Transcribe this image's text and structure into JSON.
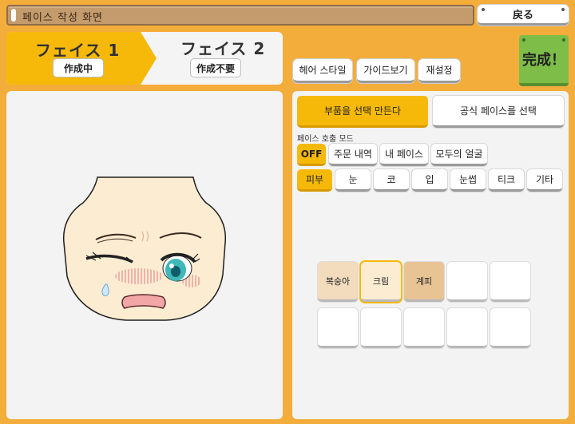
{
  "titlebar": {
    "title": "페이스 작성 화면"
  },
  "back_button": {
    "label": "戻る"
  },
  "tabs": [
    {
      "title": "フェイス 1",
      "status": "作成中"
    },
    {
      "title": "フェイス 2",
      "status": "作成不要"
    }
  ],
  "toolbar": {
    "hair_style": "헤어 스타일",
    "guide_view": "가이드보기",
    "reset": "재설정"
  },
  "done_button": {
    "label": "完成！"
  },
  "mode_buttons": {
    "make_parts": "부품을 선택 만든다",
    "official_face": "공식 페이스를 선택"
  },
  "call_mode": {
    "label": "페이스 호출 모드",
    "options": [
      "OFF",
      "주문 내역",
      "내 페이스",
      "모두의 얼굴"
    ]
  },
  "categories": [
    "피부",
    "눈",
    "코",
    "입",
    "눈썹",
    "티크",
    "기타"
  ],
  "skin_swatches": [
    {
      "label": "복숭아",
      "color": "#f2dcbd",
      "selected": false
    },
    {
      "label": "크림",
      "color": "#fbecd2",
      "selected": true
    },
    {
      "label": "계피",
      "color": "#e8c495",
      "selected": false
    },
    {
      "label": "",
      "color": "#ffffff",
      "selected": false
    },
    {
      "label": "",
      "color": "#ffffff",
      "selected": false
    },
    {
      "label": "",
      "color": "#ffffff",
      "selected": false
    },
    {
      "label": "",
      "color": "#ffffff",
      "selected": false
    },
    {
      "label": "",
      "color": "#ffffff",
      "selected": false
    },
    {
      "label": "",
      "color": "#ffffff",
      "selected": false
    },
    {
      "label": "",
      "color": "#ffffff",
      "selected": false
    }
  ],
  "colors": {
    "accent": "#f6b90a",
    "background": "#f3ad3a",
    "done": "#7dbd48",
    "face_skin": "#fbecd2",
    "eye": "#3fb8b8",
    "blush": "#f0a8a8"
  }
}
